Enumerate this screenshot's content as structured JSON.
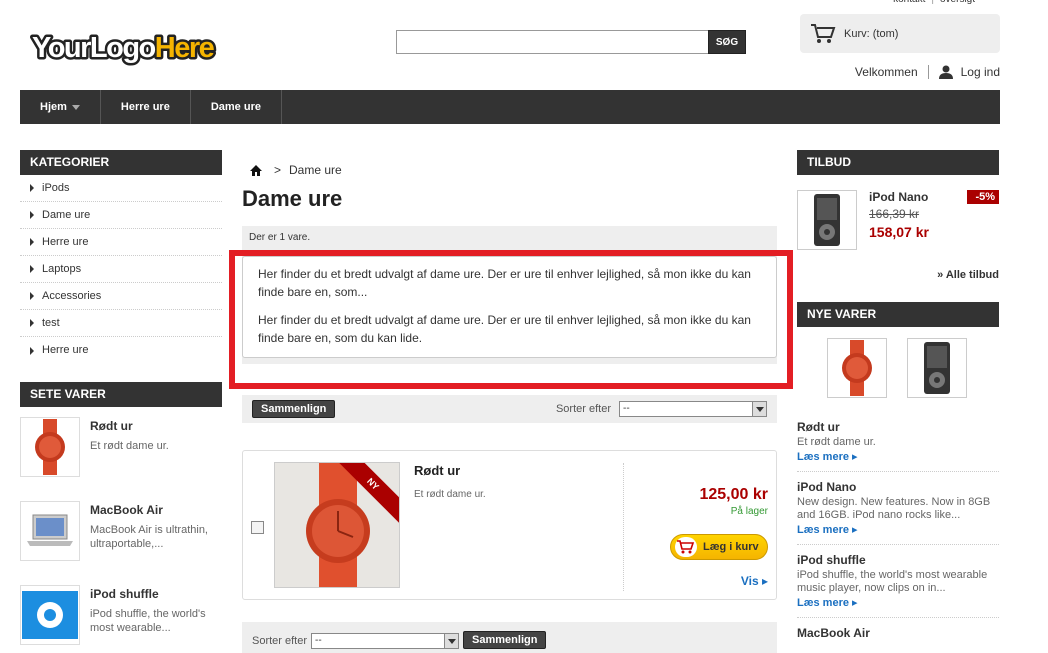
{
  "header": {
    "top_links": [
      "kontakt",
      "oversigt"
    ],
    "logo_text": "YourLogoHere",
    "search_button": "SØG",
    "search_value": "",
    "cart_label": "Kurv: (tom)",
    "welcome": "Velkommen",
    "login": "Log ind"
  },
  "nav": {
    "items": [
      {
        "label": "Hjem"
      },
      {
        "label": "Herre ure"
      },
      {
        "label": "Dame ure"
      }
    ]
  },
  "sidebar_left": {
    "categories_title": "KATEGORIER",
    "categories": [
      "iPods",
      "Dame ure",
      "Herre ure",
      "Laptops",
      "Accessories",
      "test",
      "Herre ure"
    ],
    "seen_title": "SETE VARER",
    "seen_items": [
      {
        "title": "Rødt ur",
        "desc": "Et rødt dame ur."
      },
      {
        "title": "MacBook Air",
        "desc": "MacBook Air is ultrathin, ultraportable,..."
      },
      {
        "title": "iPod shuffle",
        "desc": "iPod shuffle, the world's most wearable..."
      }
    ]
  },
  "main": {
    "breadcrumb_current": "Dame ure",
    "title": "Dame ure",
    "count_text": "Der er 1 vare.",
    "description": [
      "Her finder du et bredt udvalgt af dame ure. Der er ure til enhver lejlighed, så mon ikke du kan finde bare en, som...",
      "Her finder du et bredt udvalgt af dame ure. Der er ure til enhver lejlighed, så mon ikke du kan finde bare en, som du kan lide."
    ],
    "compare_button": "Sammenlign",
    "sort_label": "Sorter efter",
    "sort_value": "--",
    "product": {
      "badge": "NY",
      "name": "Rødt ur",
      "desc": "Et rødt dame ur.",
      "price": "125,00 kr",
      "stock": "På lager",
      "add_to_cart": "Læg i kurv",
      "view": "Vis"
    }
  },
  "sidebar_right": {
    "offers_title": "TILBUD",
    "offer": {
      "name": "iPod Nano",
      "old_price": "166,39 kr",
      "new_price": "158,07 kr",
      "discount": "-5%"
    },
    "all_offers": "» Alle tilbud",
    "new_title": "NYE VARER",
    "new_items": [
      {
        "title": "Rødt ur",
        "desc": "Et rødt dame ur.",
        "more": "Læs mere"
      },
      {
        "title": "iPod Nano",
        "desc": "New design. New features. Now in 8GB and 16GB. iPod nano rocks like...",
        "more": "Læs mere"
      },
      {
        "title": "iPod shuffle",
        "desc": "iPod shuffle, the world's most wearable music player, now clips on in...",
        "more": "Læs mere"
      },
      {
        "title": "MacBook Air",
        "desc": "",
        "more": ""
      }
    ]
  },
  "colors": {
    "dark": "#333333",
    "accent_red": "#aa0000",
    "link_blue": "#1a6fc0",
    "highlight_red": "#e31e24",
    "cart_yellow": "#ffd400"
  }
}
